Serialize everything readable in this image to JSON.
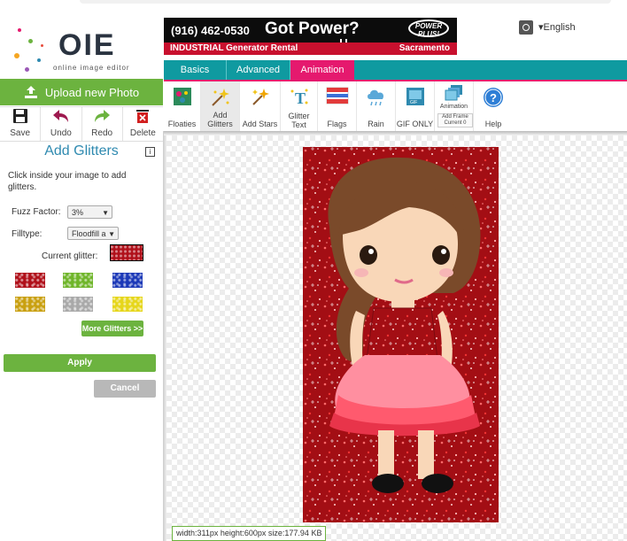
{
  "app": {
    "logo_text": "OIE",
    "logo_subtitle": "online image editor"
  },
  "sidebar": {
    "upload_label": "Upload new Photo",
    "tools": [
      {
        "label": "Save",
        "icon": "floppy-disk-icon"
      },
      {
        "label": "Undo",
        "icon": "undo-arrow-icon"
      },
      {
        "label": "Redo",
        "icon": "redo-arrow-icon"
      },
      {
        "label": "Delete",
        "icon": "trash-icon"
      }
    ],
    "panel_title": "Add Glitters",
    "hint": "Click inside your image to add glitters.",
    "fuzz_label": "Fuzz Factor:",
    "fuzz_value": "3%",
    "filltype_label": "Filltype:",
    "filltype_value": "Floodfill a",
    "current_glitter_label": "Current glitter:",
    "current_glitter_color": "#b0101a",
    "swatches": [
      "#b0101a",
      "#6fb52a",
      "#1c39b8",
      "#c9a010",
      "#a9a9a9",
      "#e6d61a"
    ],
    "more_label": "More Glitters >>",
    "apply_label": "Apply",
    "cancel_label": "Cancel"
  },
  "ad": {
    "phone": "(916) 462-0530",
    "headline": "Got Power?",
    "brand": "POWER PLUS!",
    "sub_left": "INDUSTRIAL Generator Rental",
    "sub_right": "Sacramento"
  },
  "header": {
    "language": "▾English"
  },
  "tabs": [
    {
      "label": "Basics",
      "active": false
    },
    {
      "label": "Advanced",
      "active": false
    },
    {
      "label": "Animation",
      "active": true
    }
  ],
  "toolbar": [
    {
      "label": "Floaties",
      "icon": "floaties-icon"
    },
    {
      "label": "Add Glitters",
      "icon": "glitter-wand-icon",
      "active": true
    },
    {
      "label": "Add Stars",
      "icon": "stars-wand-icon"
    },
    {
      "label": "Glitter Text",
      "icon": "glitter-text-icon"
    },
    {
      "label": "Flags",
      "icon": "flag-icon"
    },
    {
      "label": "Rain",
      "icon": "rain-cloud-icon"
    },
    {
      "label": "GIF ONLY",
      "icon": "gif-icon"
    },
    {
      "label_top": "Animation",
      "label": "Add Frame Current 0",
      "icon": "animation-frames-icon"
    },
    {
      "label": "Help",
      "icon": "help-icon"
    }
  ],
  "status": {
    "text": "width:311px  height:600px  size:177.94 KB"
  },
  "colors": {
    "green": "#6cb33f",
    "teal": "#0f9aa0",
    "pink": "#e5196e",
    "title_blue": "#2f8ab0",
    "glitter_red": "#b0101a"
  }
}
